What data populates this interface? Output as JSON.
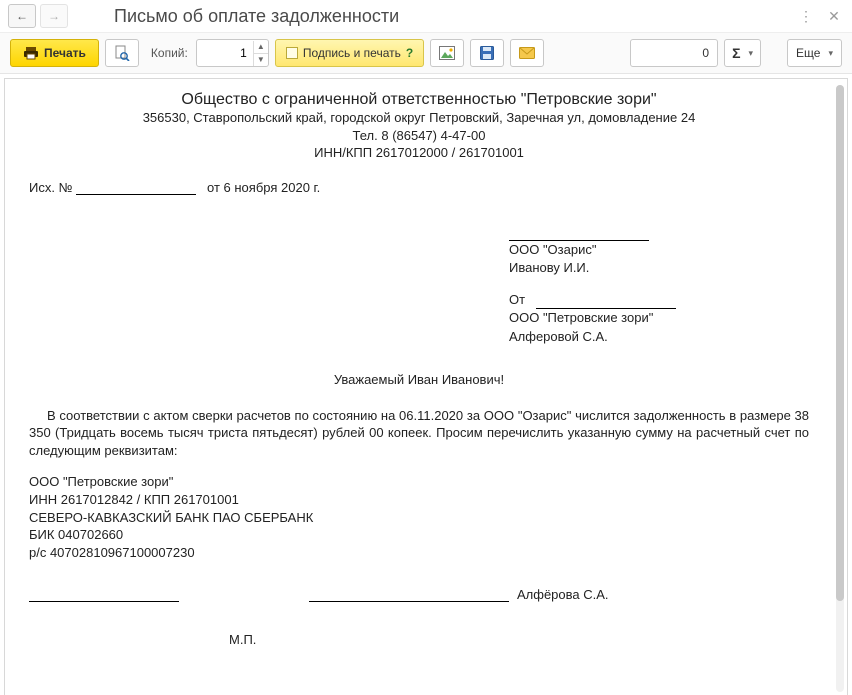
{
  "window": {
    "title": "Письмо об оплате задолженности"
  },
  "toolbar": {
    "print_label": "Печать",
    "copies_label": "Копий:",
    "copies_value": "1",
    "sign_label": "Подпись и печать",
    "sum_value": "0",
    "more_label": "Еще"
  },
  "doc": {
    "org_title": "Общество с ограниченной ответственностью \"Петровские зори\"",
    "address": "356530, Ставропольский край, городской округ Петровский, Заречная ул, домовладение 24",
    "phone": "Тел. 8 (86547) 4-47-00",
    "inn_kpp": "ИНН/КПП 2617012000 / 261701001",
    "ref_prefix": "Исх. №",
    "ref_date": "от 6 ноября 2020 г.",
    "to_org": "ООО \"Озарис\"",
    "to_person": "Иванову  И.И.",
    "from_label": "От",
    "from_org": "ООО \"Петровские зори\"",
    "from_person": "Алферовой С.А.",
    "salutation": "Уважаемый Иван Иванович!",
    "body": "В соответствии с актом сверки расчетов по состоянию на 06.11.2020 за ООО \"Озарис\" числится задолженность в размере 38 350 (Тридцать восемь тысяч триста пятьдесят) рублей 00 копеек. Просим перечислить указанную сумму на расчетный счет  по следующим реквизитам:",
    "req_org": "ООО \"Петровские зори\"",
    "req_innkpp": "ИНН 2617012842 / КПП 261701001",
    "req_bank": "СЕВЕРО-КАВКАЗСКИЙ БАНК ПАО СБЕРБАНК",
    "req_bik": "БИК 040702660",
    "req_acc": "р/с 40702810967100007230",
    "signer": "Алфёрова С.А.",
    "mp": "М.П."
  }
}
